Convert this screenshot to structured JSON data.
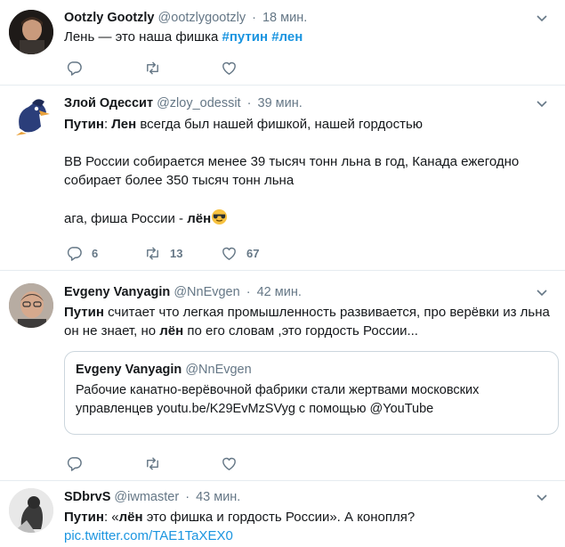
{
  "tweets": [
    {
      "name": "Ootzly Gootzly",
      "handle": "@ootzlygootzly",
      "dot": "·",
      "time": "18 мин.",
      "line1_pre": "Лень — это наша фишка ",
      "tag1": "#путин",
      "tag_sep": " ",
      "tag2": "#лен"
    },
    {
      "name": "Злой Одессит",
      "handle": "@zloy_odessit",
      "dot": "·",
      "time": "39 мин.",
      "line1_b1": "Путин",
      "line1_mid": ": ",
      "line1_b2": "Лен",
      "line1_rest": " всегда был нашей фишкой, нашей гордостью",
      "para2_l1": "ВВ России собирается менее 39 тысяч тонн льна в год, Канада ежегодно",
      "para2_l2": "собирает более 350 тысяч тонн льна",
      "para3_pre": "ага, фиша России - ",
      "para3_b": "лён",
      "reply_count": "6",
      "retweet_count": "13",
      "like_count": "67"
    },
    {
      "name": "Evgeny Vanyagin",
      "handle": "@NnEvgen",
      "dot": "·",
      "time": "42 мин.",
      "l1_b": "Путин",
      "l1_rest": " считает что легкая промышленность развивается, про верёвки из льна",
      "l2_pre": "он не знает, но ",
      "l2_b": "лён",
      "l2_rest": " по его словам ,это  гордость России...",
      "quote": {
        "name": "Evgeny Vanyagin",
        "handle": "@NnEvgen",
        "l1": "Рабочие канатно-верёвочной фабрики стали жертвами московских",
        "l2": "управленцев youtu.be/K29EvMzSVyg с помощью @YouTube"
      }
    },
    {
      "name": "SDbrvS",
      "handle": "@iwmaster",
      "dot": "·",
      "time": "43 мин.",
      "l1_b1": "Путин",
      "l1_mid": ": «",
      "l1_b2": "лён",
      "l1_rest": " это фишка и гордость России». А конопля?",
      "link": "pic.twitter.com/TAE1TaXEX0"
    }
  ],
  "colors": {
    "link": "#1b95e0",
    "meta": "#657786",
    "border": "#e6ecf0",
    "like": "#657786"
  }
}
